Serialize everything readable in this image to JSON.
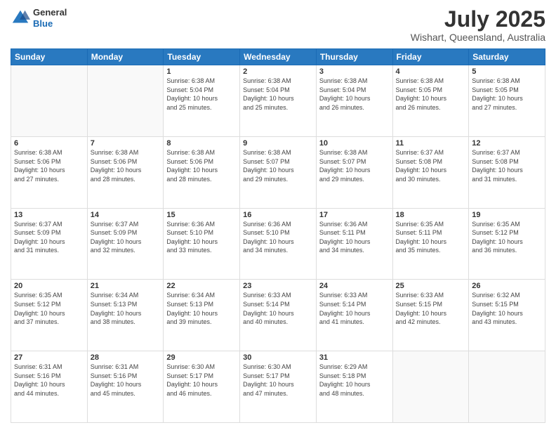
{
  "header": {
    "logo_line1": "General",
    "logo_line2": "Blue",
    "main_title": "July 2025",
    "subtitle": "Wishart, Queensland, Australia"
  },
  "weekdays": [
    "Sunday",
    "Monday",
    "Tuesday",
    "Wednesday",
    "Thursday",
    "Friday",
    "Saturday"
  ],
  "weeks": [
    [
      {
        "day": "",
        "detail": ""
      },
      {
        "day": "",
        "detail": ""
      },
      {
        "day": "1",
        "detail": "Sunrise: 6:38 AM\nSunset: 5:04 PM\nDaylight: 10 hours\nand 25 minutes."
      },
      {
        "day": "2",
        "detail": "Sunrise: 6:38 AM\nSunset: 5:04 PM\nDaylight: 10 hours\nand 25 minutes."
      },
      {
        "day": "3",
        "detail": "Sunrise: 6:38 AM\nSunset: 5:04 PM\nDaylight: 10 hours\nand 26 minutes."
      },
      {
        "day": "4",
        "detail": "Sunrise: 6:38 AM\nSunset: 5:05 PM\nDaylight: 10 hours\nand 26 minutes."
      },
      {
        "day": "5",
        "detail": "Sunrise: 6:38 AM\nSunset: 5:05 PM\nDaylight: 10 hours\nand 27 minutes."
      }
    ],
    [
      {
        "day": "6",
        "detail": "Sunrise: 6:38 AM\nSunset: 5:06 PM\nDaylight: 10 hours\nand 27 minutes."
      },
      {
        "day": "7",
        "detail": "Sunrise: 6:38 AM\nSunset: 5:06 PM\nDaylight: 10 hours\nand 28 minutes."
      },
      {
        "day": "8",
        "detail": "Sunrise: 6:38 AM\nSunset: 5:06 PM\nDaylight: 10 hours\nand 28 minutes."
      },
      {
        "day": "9",
        "detail": "Sunrise: 6:38 AM\nSunset: 5:07 PM\nDaylight: 10 hours\nand 29 minutes."
      },
      {
        "day": "10",
        "detail": "Sunrise: 6:38 AM\nSunset: 5:07 PM\nDaylight: 10 hours\nand 29 minutes."
      },
      {
        "day": "11",
        "detail": "Sunrise: 6:37 AM\nSunset: 5:08 PM\nDaylight: 10 hours\nand 30 minutes."
      },
      {
        "day": "12",
        "detail": "Sunrise: 6:37 AM\nSunset: 5:08 PM\nDaylight: 10 hours\nand 31 minutes."
      }
    ],
    [
      {
        "day": "13",
        "detail": "Sunrise: 6:37 AM\nSunset: 5:09 PM\nDaylight: 10 hours\nand 31 minutes."
      },
      {
        "day": "14",
        "detail": "Sunrise: 6:37 AM\nSunset: 5:09 PM\nDaylight: 10 hours\nand 32 minutes."
      },
      {
        "day": "15",
        "detail": "Sunrise: 6:36 AM\nSunset: 5:10 PM\nDaylight: 10 hours\nand 33 minutes."
      },
      {
        "day": "16",
        "detail": "Sunrise: 6:36 AM\nSunset: 5:10 PM\nDaylight: 10 hours\nand 34 minutes."
      },
      {
        "day": "17",
        "detail": "Sunrise: 6:36 AM\nSunset: 5:11 PM\nDaylight: 10 hours\nand 34 minutes."
      },
      {
        "day": "18",
        "detail": "Sunrise: 6:35 AM\nSunset: 5:11 PM\nDaylight: 10 hours\nand 35 minutes."
      },
      {
        "day": "19",
        "detail": "Sunrise: 6:35 AM\nSunset: 5:12 PM\nDaylight: 10 hours\nand 36 minutes."
      }
    ],
    [
      {
        "day": "20",
        "detail": "Sunrise: 6:35 AM\nSunset: 5:12 PM\nDaylight: 10 hours\nand 37 minutes."
      },
      {
        "day": "21",
        "detail": "Sunrise: 6:34 AM\nSunset: 5:13 PM\nDaylight: 10 hours\nand 38 minutes."
      },
      {
        "day": "22",
        "detail": "Sunrise: 6:34 AM\nSunset: 5:13 PM\nDaylight: 10 hours\nand 39 minutes."
      },
      {
        "day": "23",
        "detail": "Sunrise: 6:33 AM\nSunset: 5:14 PM\nDaylight: 10 hours\nand 40 minutes."
      },
      {
        "day": "24",
        "detail": "Sunrise: 6:33 AM\nSunset: 5:14 PM\nDaylight: 10 hours\nand 41 minutes."
      },
      {
        "day": "25",
        "detail": "Sunrise: 6:33 AM\nSunset: 5:15 PM\nDaylight: 10 hours\nand 42 minutes."
      },
      {
        "day": "26",
        "detail": "Sunrise: 6:32 AM\nSunset: 5:15 PM\nDaylight: 10 hours\nand 43 minutes."
      }
    ],
    [
      {
        "day": "27",
        "detail": "Sunrise: 6:31 AM\nSunset: 5:16 PM\nDaylight: 10 hours\nand 44 minutes."
      },
      {
        "day": "28",
        "detail": "Sunrise: 6:31 AM\nSunset: 5:16 PM\nDaylight: 10 hours\nand 45 minutes."
      },
      {
        "day": "29",
        "detail": "Sunrise: 6:30 AM\nSunset: 5:17 PM\nDaylight: 10 hours\nand 46 minutes."
      },
      {
        "day": "30",
        "detail": "Sunrise: 6:30 AM\nSunset: 5:17 PM\nDaylight: 10 hours\nand 47 minutes."
      },
      {
        "day": "31",
        "detail": "Sunrise: 6:29 AM\nSunset: 5:18 PM\nDaylight: 10 hours\nand 48 minutes."
      },
      {
        "day": "",
        "detail": ""
      },
      {
        "day": "",
        "detail": ""
      }
    ]
  ]
}
